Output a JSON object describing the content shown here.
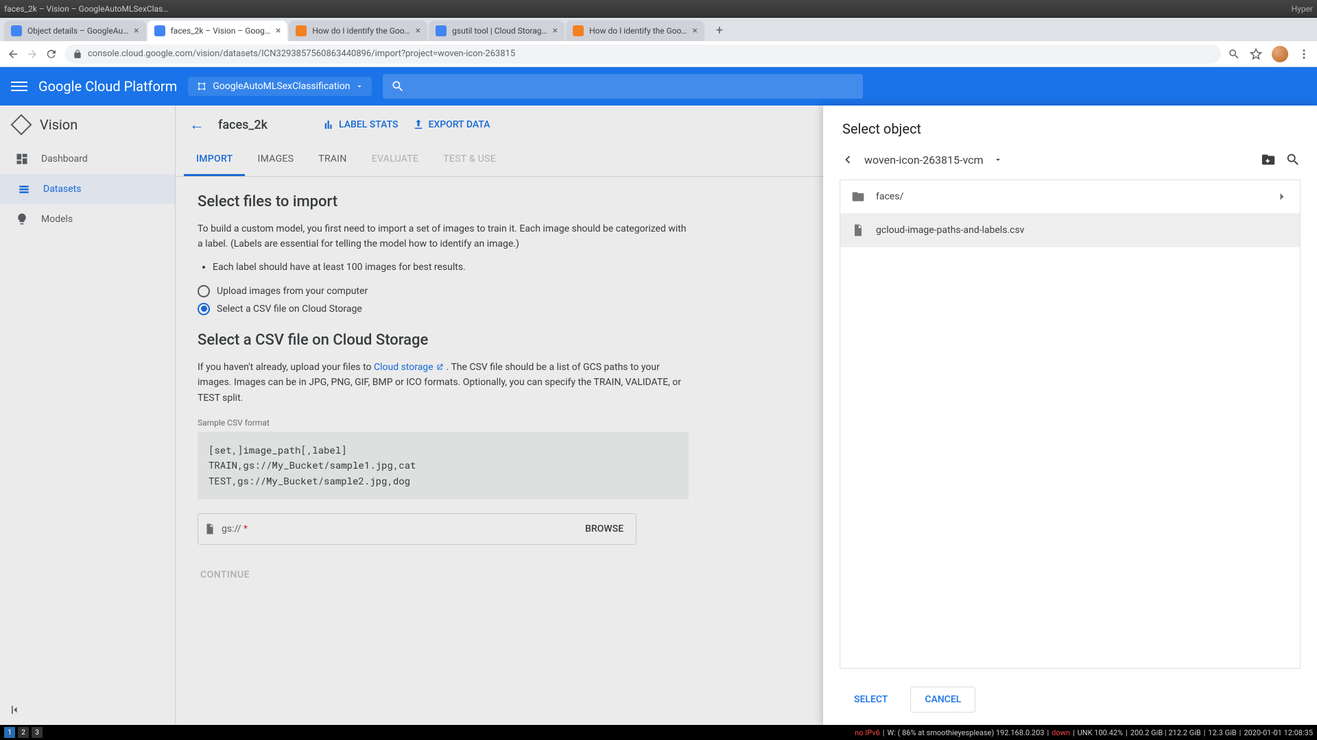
{
  "os": {
    "title_left": "faces_2k – Vision – GoogleAutoMLSexClas…",
    "title_right": "Hyper"
  },
  "chrome": {
    "tabs": [
      {
        "label": "Object details – GoogleAu…",
        "fav": "#4285f4"
      },
      {
        "label": "faces_2k – Vision – Goog…",
        "fav": "#4285f4",
        "active": true
      },
      {
        "label": "How do I identify the Goo…",
        "fav": "#f48024"
      },
      {
        "label": "gsutil tool | Cloud Storag…",
        "fav": "#4285f4"
      },
      {
        "label": "How do I identify the Goo…",
        "fav": "#f48024"
      }
    ],
    "url": "console.cloud.google.com/vision/datasets/ICN3293857560863440896/import?project=woven-icon-263815"
  },
  "gcp": {
    "logo": "Google Cloud Platform",
    "project": "GoogleAutoMLSexClassification"
  },
  "sidenav": {
    "product": "Vision",
    "items": [
      {
        "label": "Dashboard"
      },
      {
        "label": "Datasets",
        "active": true
      },
      {
        "label": "Models"
      }
    ]
  },
  "head": {
    "dataset": "faces_2k",
    "label_stats": "LABEL STATS",
    "export": "EXPORT DATA"
  },
  "tabs": {
    "import": "IMPORT",
    "images": "IMAGES",
    "train": "TRAIN",
    "evaluate": "EVALUATE",
    "test": "TEST & USE"
  },
  "import": {
    "h1": "Select files to import",
    "p1": "To build a custom model, you first need to import a set of images to train it. Each image should be categorized with a label. (Labels are essential for telling the model how to identify an image.)",
    "bullet1": "Each label should have at least 100 images for best results.",
    "radio_upload": "Upload images from your computer",
    "radio_csv": "Select a CSV file on Cloud Storage",
    "h2": "Select a CSV file on Cloud Storage",
    "p2a": "If you haven't already, upload your files to ",
    "p2link": "Cloud storage",
    "p2b": " . The CSV file should be a list of GCS paths to your images. Images can be in JPG, PNG, GIF, BMP or ICO formats. Optionally, you can specify the TRAIN, VALIDATE, or TEST split.",
    "sample_label": "Sample CSV format",
    "sample_code": "[set,]image_path[,label]\nTRAIN,gs://My_Bucket/sample1.jpg,cat\nTEST,gs://My_Bucket/sample2.jpg,dog",
    "gs_prefix": "gs:// ",
    "gs_ast": "*",
    "browse": "BROWSE",
    "continue": "CONTINUE"
  },
  "panel": {
    "title": "Select object",
    "bucket": "woven-icon-263815-vcm",
    "rows": [
      {
        "type": "folder",
        "label": "faces/"
      },
      {
        "type": "file",
        "label": "gcloud-image-paths-and-labels.csv",
        "hover": true
      }
    ],
    "select": "SELECT",
    "cancel": "CANCEL"
  },
  "taskbar": {
    "ws": [
      "1",
      "2",
      "3"
    ],
    "net": "no IPv6",
    "wifi": "W: ( 86% at smoothieyesplease) 192.168.0.203",
    "down": "down",
    "unk": "UNK 100.42%",
    "mem": "200.2 GiB | 212.2 GiB",
    "disk": "12.3 GiB",
    "time": "2020-01-01 12:08:35"
  }
}
